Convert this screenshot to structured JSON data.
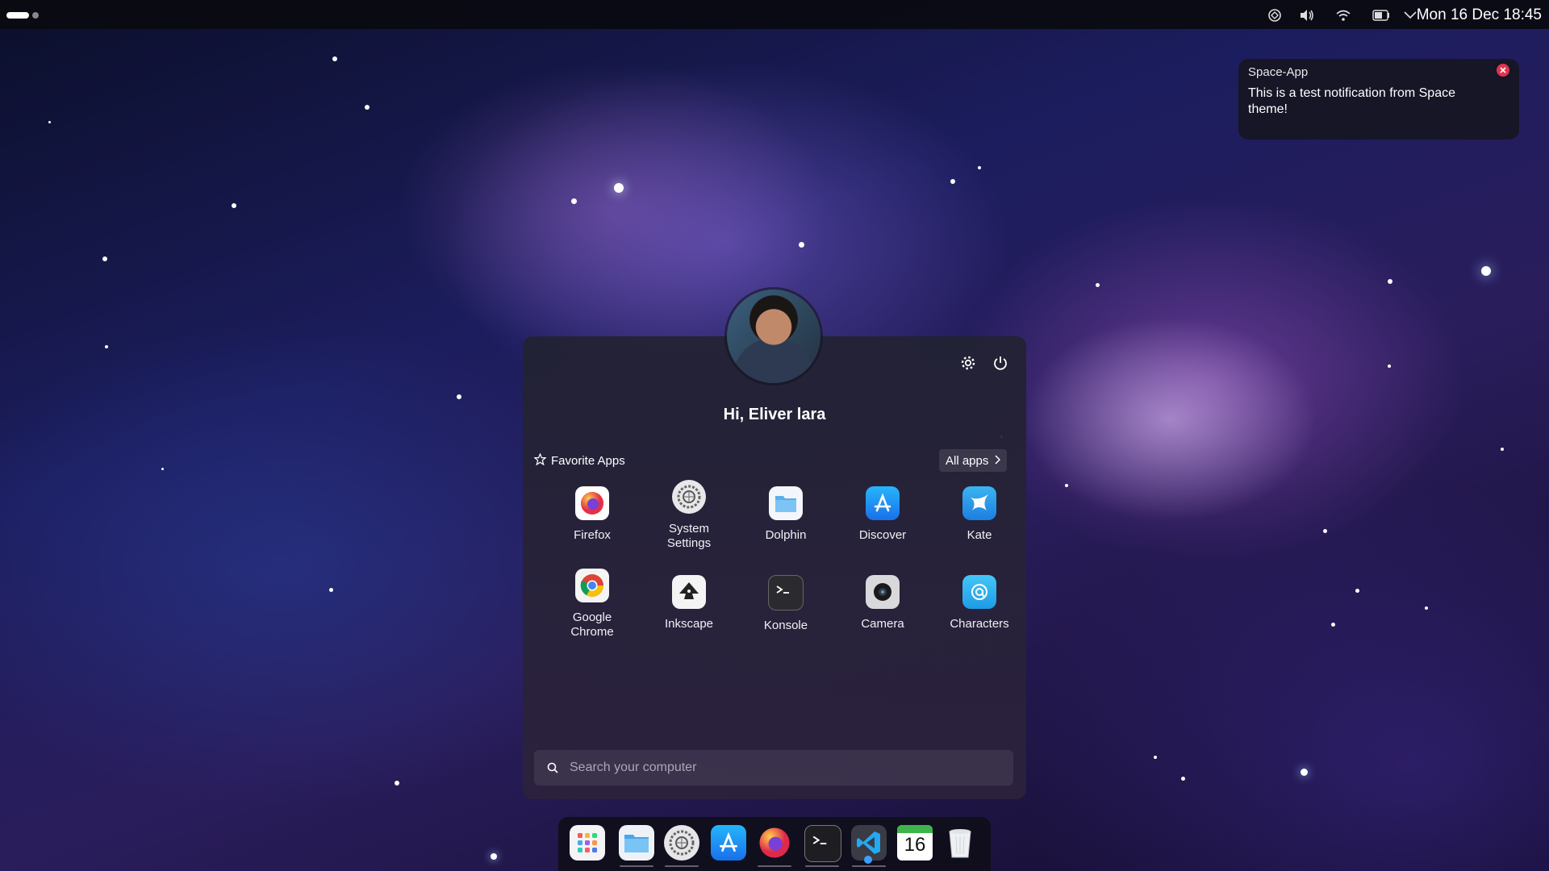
{
  "topbar": {
    "clock": "Mon 16 Dec 18:45",
    "tray_icons": [
      "kde-connect-icon",
      "volume-icon",
      "wifi-icon",
      "battery-icon",
      "chevron-down-icon"
    ]
  },
  "notification": {
    "app_name": "Space-App",
    "body": "This is a test notification from Space theme!"
  },
  "launcher": {
    "greeting": "Hi, Eliver lara",
    "favorites_heading": "Favorite Apps",
    "all_apps_label": "All apps",
    "favorites": [
      {
        "label": "Firefox",
        "icon": "firefox-icon"
      },
      {
        "label": "System Settings",
        "icon": "system-settings-icon"
      },
      {
        "label": "Dolphin",
        "icon": "dolphin-icon"
      },
      {
        "label": "Discover",
        "icon": "discover-icon"
      },
      {
        "label": "Kate",
        "icon": "kate-icon"
      },
      {
        "label": "Google Chrome",
        "icon": "chrome-icon"
      },
      {
        "label": "Inkscape",
        "icon": "inkscape-icon"
      },
      {
        "label": "Konsole",
        "icon": "konsole-icon"
      },
      {
        "label": "Camera",
        "icon": "camera-icon"
      },
      {
        "label": "Characters",
        "icon": "characters-icon"
      }
    ],
    "search_placeholder": "Search your computer"
  },
  "dock": {
    "items": [
      "app-grid-icon",
      "files-icon",
      "settings-icon",
      "discover-icon",
      "firefox-icon",
      "terminal-icon",
      "vscode-icon",
      "calendar-icon",
      "trash-icon"
    ],
    "calendar_day": "16"
  }
}
